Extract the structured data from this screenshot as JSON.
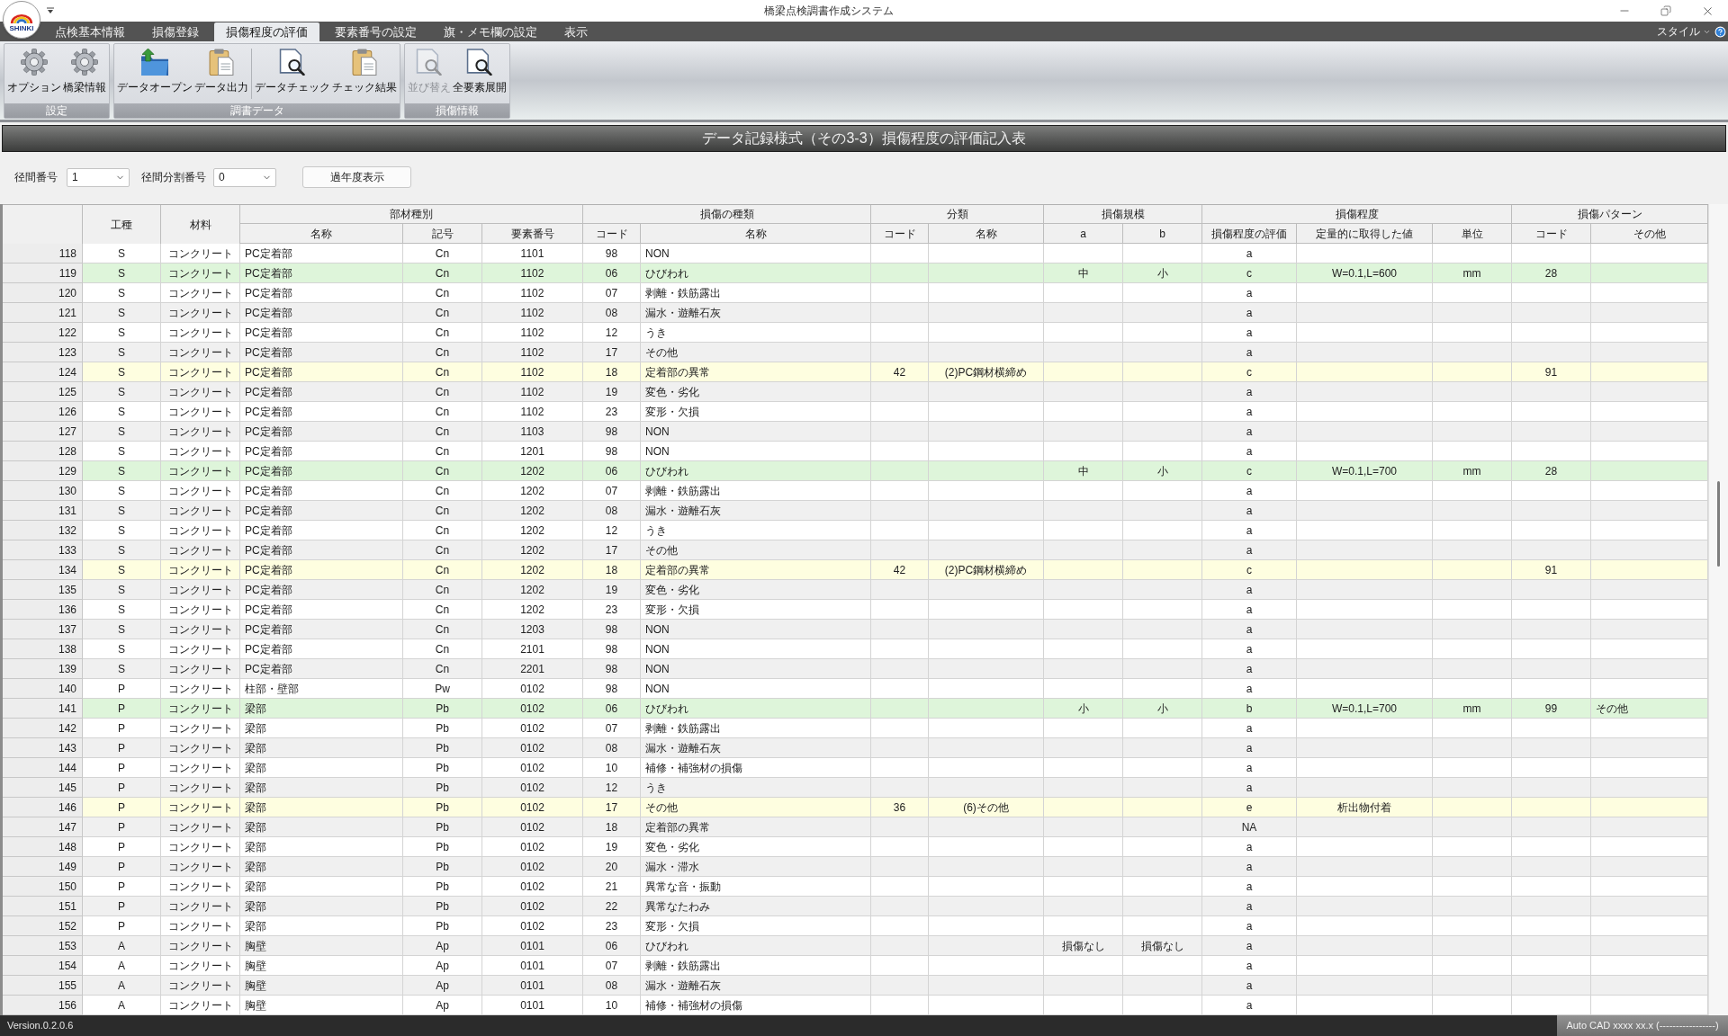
{
  "window": {
    "title": "橋梁点検調書作成システム",
    "logo_text": "SHINKI"
  },
  "tabs": [
    {
      "label": "点検基本情報",
      "selected": false
    },
    {
      "label": "損傷登録",
      "selected": false
    },
    {
      "label": "損傷程度の評価",
      "selected": true
    },
    {
      "label": "要素番号の設定",
      "selected": false
    },
    {
      "label": "旗・メモ欄の設定",
      "selected": false
    },
    {
      "label": "表示",
      "selected": false
    }
  ],
  "style_menu": {
    "label": "スタイル"
  },
  "ribbon": {
    "groups": [
      {
        "label": "設定",
        "buttons": [
          {
            "label": "オプション",
            "disabled": false
          },
          {
            "label": "橋梁情報",
            "disabled": false
          }
        ]
      },
      {
        "label": "調書データ",
        "buttons": [
          {
            "label": "データオープン",
            "disabled": false
          },
          {
            "label": "データ出力",
            "disabled": false
          },
          {
            "label": "データチェック",
            "disabled": false
          },
          {
            "label": "チェック結果",
            "disabled": false
          }
        ]
      },
      {
        "label": "損傷情報",
        "buttons": [
          {
            "label": "並び替え",
            "disabled": true
          },
          {
            "label": "全要素展開",
            "disabled": false
          }
        ]
      }
    ]
  },
  "form_title": "データ記録様式（その3-3）損傷程度の評価記入表",
  "filters": {
    "span_number": {
      "label": "径間番号",
      "value": "1"
    },
    "span_division": {
      "label": "径間分割番号",
      "value": "0"
    },
    "past_year_button": "過年度表示"
  },
  "table": {
    "columns": [
      {
        "label": "工種"
      },
      {
        "label": "材料"
      },
      {
        "label": "部材種別",
        "children": [
          {
            "label": "名称"
          },
          {
            "label": "記号"
          },
          {
            "label": "要素番号"
          }
        ]
      },
      {
        "label": "損傷の種類",
        "children": [
          {
            "label": "コード"
          },
          {
            "label": "名称"
          }
        ]
      },
      {
        "label": "分類",
        "children": [
          {
            "label": "コード"
          },
          {
            "label": "名称"
          }
        ]
      },
      {
        "label": "損傷規模",
        "children": [
          {
            "label": "a"
          },
          {
            "label": "b"
          }
        ]
      },
      {
        "label": "損傷程度",
        "children": [
          {
            "label": "損傷程度の評価"
          },
          {
            "label": "定量的に取得した値"
          },
          {
            "label": "単位"
          }
        ]
      },
      {
        "label": "損傷パターン",
        "children": [
          {
            "label": "コード"
          },
          {
            "label": "その他"
          }
        ]
      }
    ],
    "rows": [
      {
        "number": "118",
        "work_type": "S",
        "material": "コンクリート",
        "member_name": "PC定着部",
        "member_symbol": "Cn",
        "element_number": "1101",
        "damage_code": "98",
        "damage_name": "NON",
        "evaluation": "a"
      },
      {
        "number": "119",
        "work_type": "S",
        "material": "コンクリート",
        "member_name": "PC定着部",
        "member_symbol": "Cn",
        "element_number": "1102",
        "damage_code": "06",
        "damage_name": "ひびわれ",
        "scale_a": "中",
        "scale_b": "小",
        "evaluation": "c",
        "measured_value": "W=0.1,L=600",
        "unit": "mm",
        "pattern_code": "28",
        "color": "#def5da"
      },
      {
        "number": "120",
        "work_type": "S",
        "material": "コンクリート",
        "member_name": "PC定着部",
        "member_symbol": "Cn",
        "element_number": "1102",
        "damage_code": "07",
        "damage_name": "剥離・鉄筋露出",
        "evaluation": "a"
      },
      {
        "number": "121",
        "work_type": "S",
        "material": "コンクリート",
        "member_name": "PC定着部",
        "member_symbol": "Cn",
        "element_number": "1102",
        "damage_code": "08",
        "damage_name": "漏水・遊離石灰",
        "evaluation": "a"
      },
      {
        "number": "122",
        "work_type": "S",
        "material": "コンクリート",
        "member_name": "PC定着部",
        "member_symbol": "Cn",
        "element_number": "1102",
        "damage_code": "12",
        "damage_name": "うき",
        "evaluation": "a"
      },
      {
        "number": "123",
        "work_type": "S",
        "material": "コンクリート",
        "member_name": "PC定着部",
        "member_symbol": "Cn",
        "element_number": "1102",
        "damage_code": "17",
        "damage_name": "その他",
        "evaluation": "a"
      },
      {
        "number": "124",
        "work_type": "S",
        "material": "コンクリート",
        "member_name": "PC定着部",
        "member_symbol": "Cn",
        "element_number": "1102",
        "damage_code": "18",
        "damage_name": "定着部の異常",
        "class_code": "42",
        "class_name": "(2)PC鋼材横締め",
        "evaluation": "c",
        "pattern_code": "91",
        "color": "#fefee0"
      },
      {
        "number": "125",
        "work_type": "S",
        "material": "コンクリート",
        "member_name": "PC定着部",
        "member_symbol": "Cn",
        "element_number": "1102",
        "damage_code": "19",
        "damage_name": "変色・劣化",
        "evaluation": "a"
      },
      {
        "number": "126",
        "work_type": "S",
        "material": "コンクリート",
        "member_name": "PC定着部",
        "member_symbol": "Cn",
        "element_number": "1102",
        "damage_code": "23",
        "damage_name": "変形・欠損",
        "evaluation": "a"
      },
      {
        "number": "127",
        "work_type": "S",
        "material": "コンクリート",
        "member_name": "PC定着部",
        "member_symbol": "Cn",
        "element_number": "1103",
        "damage_code": "98",
        "damage_name": "NON",
        "evaluation": "a"
      },
      {
        "number": "128",
        "work_type": "S",
        "material": "コンクリート",
        "member_name": "PC定着部",
        "member_symbol": "Cn",
        "element_number": "1201",
        "damage_code": "98",
        "damage_name": "NON",
        "evaluation": "a"
      },
      {
        "number": "129",
        "work_type": "S",
        "material": "コンクリート",
        "member_name": "PC定着部",
        "member_symbol": "Cn",
        "element_number": "1202",
        "damage_code": "06",
        "damage_name": "ひびわれ",
        "scale_a": "中",
        "scale_b": "小",
        "evaluation": "c",
        "measured_value": "W=0.1,L=700",
        "unit": "mm",
        "pattern_code": "28",
        "color": "#def5da"
      },
      {
        "number": "130",
        "work_type": "S",
        "material": "コンクリート",
        "member_name": "PC定着部",
        "member_symbol": "Cn",
        "element_number": "1202",
        "damage_code": "07",
        "damage_name": "剥離・鉄筋露出",
        "evaluation": "a"
      },
      {
        "number": "131",
        "work_type": "S",
        "material": "コンクリート",
        "member_name": "PC定着部",
        "member_symbol": "Cn",
        "element_number": "1202",
        "damage_code": "08",
        "damage_name": "漏水・遊離石灰",
        "evaluation": "a"
      },
      {
        "number": "132",
        "work_type": "S",
        "material": "コンクリート",
        "member_name": "PC定着部",
        "member_symbol": "Cn",
        "element_number": "1202",
        "damage_code": "12",
        "damage_name": "うき",
        "evaluation": "a"
      },
      {
        "number": "133",
        "work_type": "S",
        "material": "コンクリート",
        "member_name": "PC定着部",
        "member_symbol": "Cn",
        "element_number": "1202",
        "damage_code": "17",
        "damage_name": "その他",
        "evaluation": "a"
      },
      {
        "number": "134",
        "work_type": "S",
        "material": "コンクリート",
        "member_name": "PC定着部",
        "member_symbol": "Cn",
        "element_number": "1202",
        "damage_code": "18",
        "damage_name": "定着部の異常",
        "class_code": "42",
        "class_name": "(2)PC鋼材横締め",
        "evaluation": "c",
        "pattern_code": "91",
        "color": "#fefee0"
      },
      {
        "number": "135",
        "work_type": "S",
        "material": "コンクリート",
        "member_name": "PC定着部",
        "member_symbol": "Cn",
        "element_number": "1202",
        "damage_code": "19",
        "damage_name": "変色・劣化",
        "evaluation": "a"
      },
      {
        "number": "136",
        "work_type": "S",
        "material": "コンクリート",
        "member_name": "PC定着部",
        "member_symbol": "Cn",
        "element_number": "1202",
        "damage_code": "23",
        "damage_name": "変形・欠損",
        "evaluation": "a"
      },
      {
        "number": "137",
        "work_type": "S",
        "material": "コンクリート",
        "member_name": "PC定着部",
        "member_symbol": "Cn",
        "element_number": "1203",
        "damage_code": "98",
        "damage_name": "NON",
        "evaluation": "a"
      },
      {
        "number": "138",
        "work_type": "S",
        "material": "コンクリート",
        "member_name": "PC定着部",
        "member_symbol": "Cn",
        "element_number": "2101",
        "damage_code": "98",
        "damage_name": "NON",
        "evaluation": "a"
      },
      {
        "number": "139",
        "work_type": "S",
        "material": "コンクリート",
        "member_name": "PC定着部",
        "member_symbol": "Cn",
        "element_number": "2201",
        "damage_code": "98",
        "damage_name": "NON",
        "evaluation": "a"
      },
      {
        "number": "140",
        "work_type": "P",
        "material": "コンクリート",
        "member_name": "柱部・壁部",
        "member_symbol": "Pw",
        "element_number": "0102",
        "damage_code": "98",
        "damage_name": "NON",
        "evaluation": "a"
      },
      {
        "number": "141",
        "work_type": "P",
        "material": "コンクリート",
        "member_name": "梁部",
        "member_symbol": "Pb",
        "element_number": "0102",
        "damage_code": "06",
        "damage_name": "ひびわれ",
        "scale_a": "小",
        "scale_b": "小",
        "evaluation": "b",
        "measured_value": "W=0.1,L=700",
        "unit": "mm",
        "pattern_code": "99",
        "pattern_other": "その他",
        "color": "#def5da"
      },
      {
        "number": "142",
        "work_type": "P",
        "material": "コンクリート",
        "member_name": "梁部",
        "member_symbol": "Pb",
        "element_number": "0102",
        "damage_code": "07",
        "damage_name": "剥離・鉄筋露出",
        "evaluation": "a"
      },
      {
        "number": "143",
        "work_type": "P",
        "material": "コンクリート",
        "member_name": "梁部",
        "member_symbol": "Pb",
        "element_number": "0102",
        "damage_code": "08",
        "damage_name": "漏水・遊離石灰",
        "evaluation": "a"
      },
      {
        "number": "144",
        "work_type": "P",
        "material": "コンクリート",
        "member_name": "梁部",
        "member_symbol": "Pb",
        "element_number": "0102",
        "damage_code": "10",
        "damage_name": "補修・補強材の損傷",
        "evaluation": "a"
      },
      {
        "number": "145",
        "work_type": "P",
        "material": "コンクリート",
        "member_name": "梁部",
        "member_symbol": "Pb",
        "element_number": "0102",
        "damage_code": "12",
        "damage_name": "うき",
        "evaluation": "a"
      },
      {
        "number": "146",
        "work_type": "P",
        "material": "コンクリート",
        "member_name": "梁部",
        "member_symbol": "Pb",
        "element_number": "0102",
        "damage_code": "17",
        "damage_name": "その他",
        "class_code": "36",
        "class_name": "(6)その他",
        "evaluation": "e",
        "measured_value": "析出物付着",
        "color": "#fefee0"
      },
      {
        "number": "147",
        "work_type": "P",
        "material": "コンクリート",
        "member_name": "梁部",
        "member_symbol": "Pb",
        "element_number": "0102",
        "damage_code": "18",
        "damage_name": "定着部の異常",
        "evaluation": "NA"
      },
      {
        "number": "148",
        "work_type": "P",
        "material": "コンクリート",
        "member_name": "梁部",
        "member_symbol": "Pb",
        "element_number": "0102",
        "damage_code": "19",
        "damage_name": "変色・劣化",
        "evaluation": "a"
      },
      {
        "number": "149",
        "work_type": "P",
        "material": "コンクリート",
        "member_name": "梁部",
        "member_symbol": "Pb",
        "element_number": "0102",
        "damage_code": "20",
        "damage_name": "漏水・滞水",
        "evaluation": "a"
      },
      {
        "number": "150",
        "work_type": "P",
        "material": "コンクリート",
        "member_name": "梁部",
        "member_symbol": "Pb",
        "element_number": "0102",
        "damage_code": "21",
        "damage_name": "異常な音・振動",
        "evaluation": "a"
      },
      {
        "number": "151",
        "work_type": "P",
        "material": "コンクリート",
        "member_name": "梁部",
        "member_symbol": "Pb",
        "element_number": "0102",
        "damage_code": "22",
        "damage_name": "異常なたわみ",
        "evaluation": "a"
      },
      {
        "number": "152",
        "work_type": "P",
        "material": "コンクリート",
        "member_name": "梁部",
        "member_symbol": "Pb",
        "element_number": "0102",
        "damage_code": "23",
        "damage_name": "変形・欠損",
        "evaluation": "a"
      },
      {
        "number": "153",
        "work_type": "A",
        "material": "コンクリート",
        "member_name": "胸壁",
        "member_symbol": "Ap",
        "element_number": "0101",
        "damage_code": "06",
        "damage_name": "ひびわれ",
        "scale_a": "損傷なし",
        "scale_b": "損傷なし",
        "evaluation": "a"
      },
      {
        "number": "154",
        "work_type": "A",
        "material": "コンクリート",
        "member_name": "胸壁",
        "member_symbol": "Ap",
        "element_number": "0101",
        "damage_code": "07",
        "damage_name": "剥離・鉄筋露出",
        "evaluation": "a"
      },
      {
        "number": "155",
        "work_type": "A",
        "material": "コンクリート",
        "member_name": "胸壁",
        "member_symbol": "Ap",
        "element_number": "0101",
        "damage_code": "08",
        "damage_name": "漏水・遊離石灰",
        "evaluation": "a"
      },
      {
        "number": "156",
        "work_type": "A",
        "material": "コンクリート",
        "member_name": "胸壁",
        "member_symbol": "Ap",
        "element_number": "0101",
        "damage_code": "10",
        "damage_name": "補修・補強材の損傷",
        "evaluation": "a"
      }
    ]
  },
  "status_bar": {
    "version": "Version.0.2.0.6",
    "cad_info": "Auto CAD xxxx xx.x (-----------------)"
  }
}
